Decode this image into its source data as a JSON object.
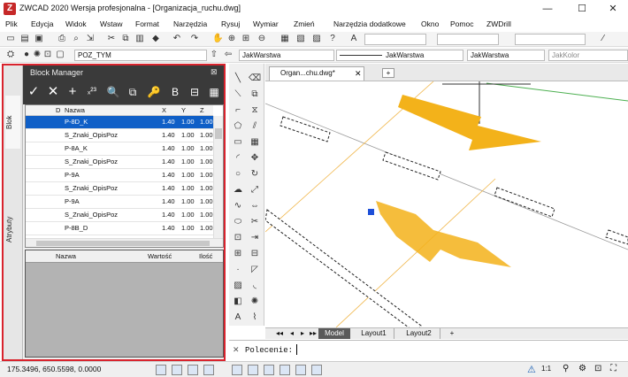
{
  "window": {
    "title": "ZWCAD 2020 Wersja profesjonalna - [Organizacja_ruchu.dwg]",
    "logo": "Z",
    "controls": [
      "—",
      "☐",
      "✕"
    ]
  },
  "menu": [
    "Plik",
    "Edycja",
    "Widok",
    "Wstaw",
    "Format",
    "Narzędzia",
    "Rysuj",
    "Wymiar",
    "Zmień",
    "Narzędzia dodatkowe",
    "Okno",
    "Pomoc",
    "ZWDrill"
  ],
  "layer_bar": {
    "layer": "POZ_TYM",
    "linetype": "JakWarstwa",
    "lineweight": "JakWarstwa",
    "linestyle": "JakWarstwa",
    "color": "JakKolor"
  },
  "block_manager": {
    "title": "Block Manager",
    "side_tabs": [
      "Blok",
      "Atrybuty"
    ],
    "toolbar": [
      "✓",
      "✕",
      "+",
      "ₓ²³",
      "🔍",
      "⧉",
      "🔑",
      "B",
      "⊟",
      "▦"
    ],
    "columns": [
      "D",
      "Nazwa",
      "X",
      "Y",
      "Z"
    ],
    "rows": [
      {
        "name": "P-8D_K",
        "x": "1.40",
        "y": "1.00",
        "z": "1.00",
        "selected": true
      },
      {
        "name": "S_Znaki_OpisPoz",
        "x": "1.40",
        "y": "1.00",
        "z": "1.00"
      },
      {
        "name": "P-8A_K",
        "x": "1.40",
        "y": "1.00",
        "z": "1.00"
      },
      {
        "name": "S_Znaki_OpisPoz",
        "x": "1.40",
        "y": "1.00",
        "z": "1.00"
      },
      {
        "name": "P-9A",
        "x": "1.40",
        "y": "1.00",
        "z": "1.00"
      },
      {
        "name": "S_Znaki_OpisPoz",
        "x": "1.40",
        "y": "1.00",
        "z": "1.00"
      },
      {
        "name": "P-9A",
        "x": "1.40",
        "y": "1.00",
        "z": "1.00"
      },
      {
        "name": "S_Znaki_OpisPoz",
        "x": "1.40",
        "y": "1.00",
        "z": "1.00"
      },
      {
        "name": "P-8B_D",
        "x": "1.40",
        "y": "1.00",
        "z": "1.00"
      }
    ],
    "attr_columns": [
      "Nazwa",
      "Wartość",
      "Ilość"
    ]
  },
  "document": {
    "tab": "Organ...chu.dwg*"
  },
  "layout_tabs": [
    "Model",
    "Layout1",
    "Layout2",
    "+"
  ],
  "command": {
    "label": "Polecenie:"
  },
  "status": {
    "coords": "175.3496, 650.5598, 0.0000",
    "scale": "1:1"
  },
  "colors": {
    "accent": "#0f5fc7",
    "highlight_border": "#d9232d",
    "arrow": "#f3b21a",
    "panel_dark": "#3a3a3a"
  }
}
